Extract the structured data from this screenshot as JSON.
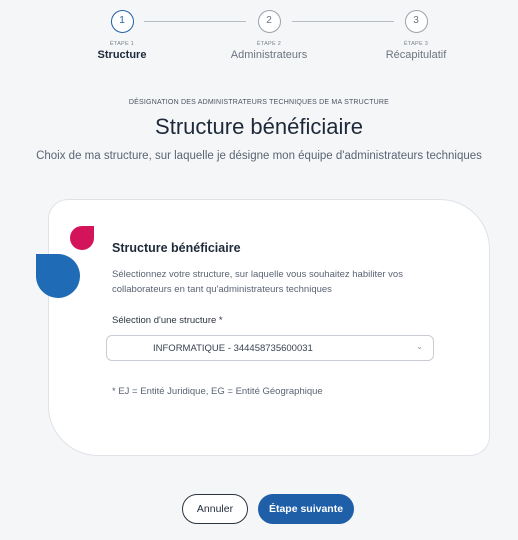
{
  "stepper": {
    "steps": [
      {
        "number": "1",
        "label": "ÉTAPE 1",
        "name": "Structure"
      },
      {
        "number": "2",
        "label": "ÉTAPE 2",
        "name": "Administrateurs"
      },
      {
        "number": "3",
        "label": "ÉTAPE 3",
        "name": "Récapitulatif"
      }
    ],
    "current_step": 1
  },
  "header": {
    "kicker": "DÉSIGNATION DES ADMINISTRATEURS TECHNIQUES DE MA STRUCTURE",
    "title": "Structure bénéficiaire",
    "subtitle": "Choix de ma structure, sur laquelle je désigne mon équipe d'administrateurs techniques"
  },
  "card": {
    "title": "Structure bénéficiaire",
    "description": "Sélectionnez votre structure, sur laquelle vous souhaitez habiliter vos collaborateurs en tant qu'administrateurs techniques",
    "select_label": "Sélection d'une structure *",
    "select_value": "INFORMATIQUE - 344458735600031",
    "note": "* EJ = Entité Juridique, EG = Entité Géographique"
  },
  "actions": {
    "cancel_label": "Annuler",
    "next_label": "Étape suivante"
  },
  "colors": {
    "primary": "#1f5fa8",
    "logo_blue": "#1f6bb5",
    "logo_red": "#d4145a"
  }
}
